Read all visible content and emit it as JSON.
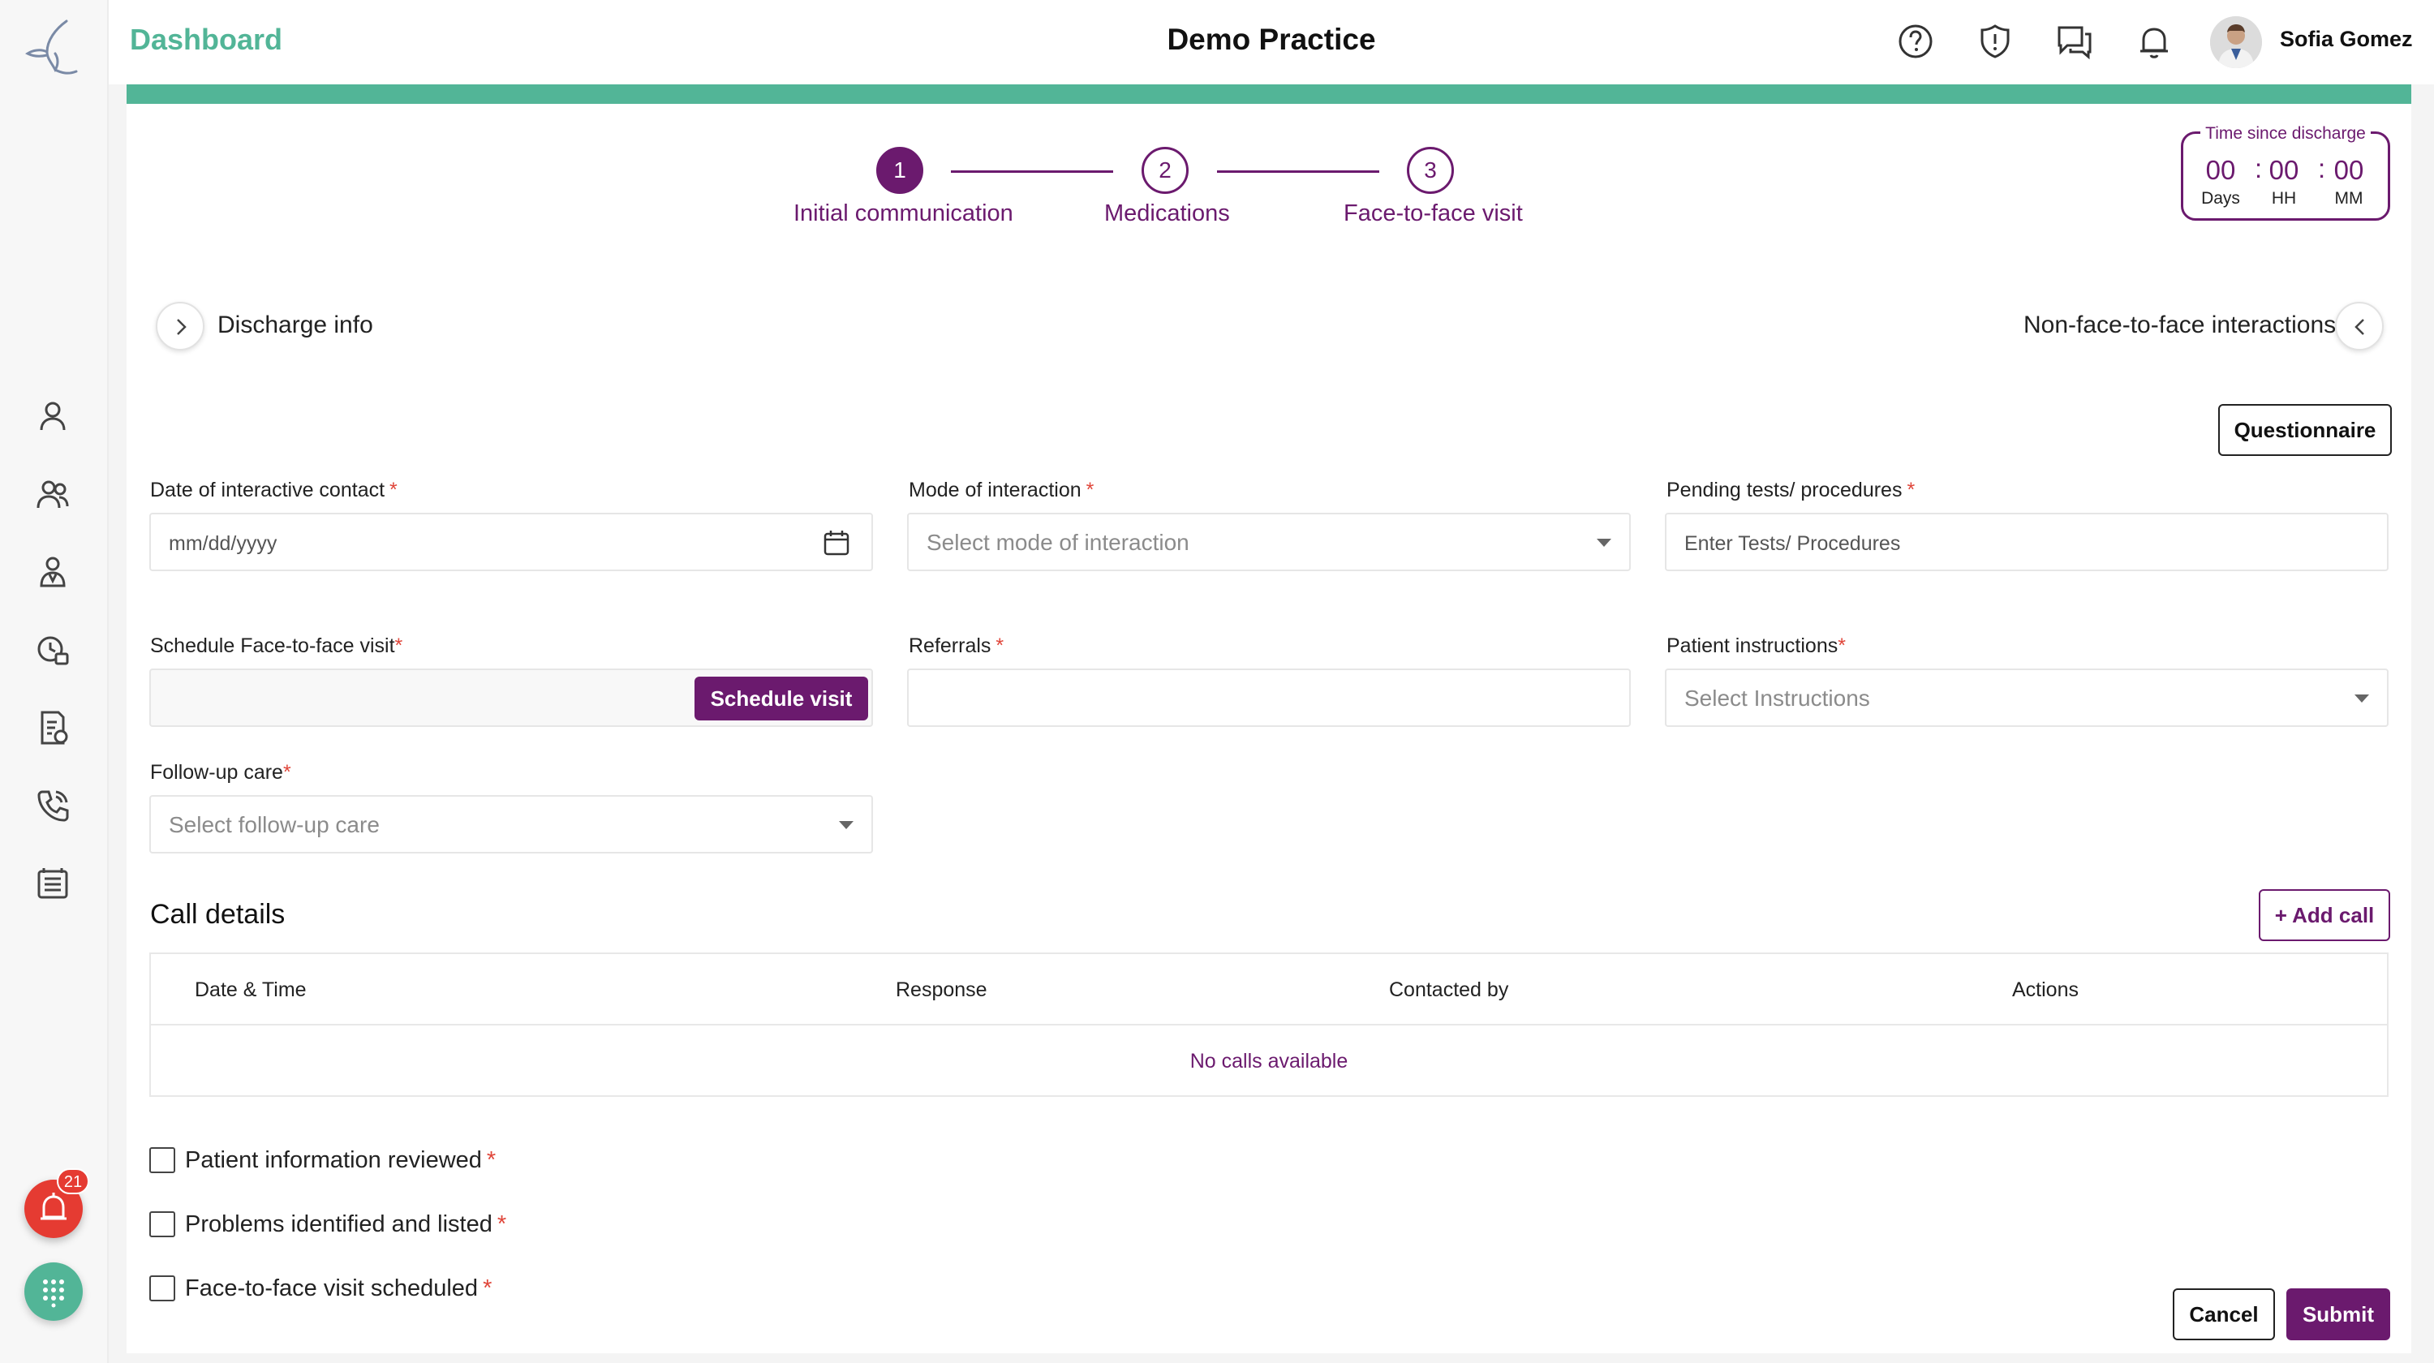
{
  "header": {
    "title": "Dashboard",
    "practice": "Demo Practice",
    "user_name": "Sofia Gomez",
    "icons": [
      "help-icon",
      "alert-shield-icon",
      "chat-icon",
      "bell-icon"
    ]
  },
  "sidebar": {
    "items": [
      "patient-icon",
      "patients-group-icon",
      "care-team-icon",
      "schedule-icon",
      "billing-icon",
      "phone-icon",
      "reports-icon"
    ],
    "alarm_count": "21"
  },
  "steps": [
    {
      "number": "1",
      "label": "Initial communication",
      "active": true
    },
    {
      "number": "2",
      "label": "Medications",
      "active": false
    },
    {
      "number": "3",
      "label": "Face-to-face visit",
      "active": false
    }
  ],
  "timer": {
    "title": "Time since discharge",
    "days": "00",
    "hours": "00",
    "minutes": "00",
    "days_label": "Days",
    "hours_label": "HH",
    "minutes_label": "MM",
    "separator": ":"
  },
  "panels": {
    "left": "Discharge info",
    "right": "Non-face-to-face interactions"
  },
  "buttons": {
    "questionnaire": "Questionnaire",
    "schedule_visit": "Schedule visit",
    "add_call": "+ Add call",
    "cancel": "Cancel",
    "submit": "Submit"
  },
  "form": {
    "date_label": "Date of interactive contact",
    "date_placeholder": "mm/dd/yyyy",
    "mode_label": "Mode of interaction",
    "mode_placeholder": "Select mode of interaction",
    "tests_label": "Pending tests/ procedures",
    "tests_placeholder": "Enter Tests/ Procedures",
    "schedule_label": "Schedule Face-to-face visit",
    "referrals_label": "Referrals",
    "instructions_label": "Patient instructions",
    "instructions_placeholder": "Select Instructions",
    "followup_label": "Follow-up care",
    "followup_placeholder": "Select follow-up care",
    "required_mark": "*"
  },
  "call_details": {
    "title": "Call details",
    "columns": [
      "Date & Time",
      "Response",
      "Contacted by",
      "Actions"
    ],
    "empty": "No calls available"
  },
  "checklist": [
    "Patient information reviewed",
    "Problems identified and listed",
    "Face-to-face visit scheduled"
  ],
  "colors": {
    "brand_green": "#52b597",
    "brand_purple": "#6b1a6e",
    "required_red": "#e0463a",
    "alarm_red": "#e53b32"
  }
}
